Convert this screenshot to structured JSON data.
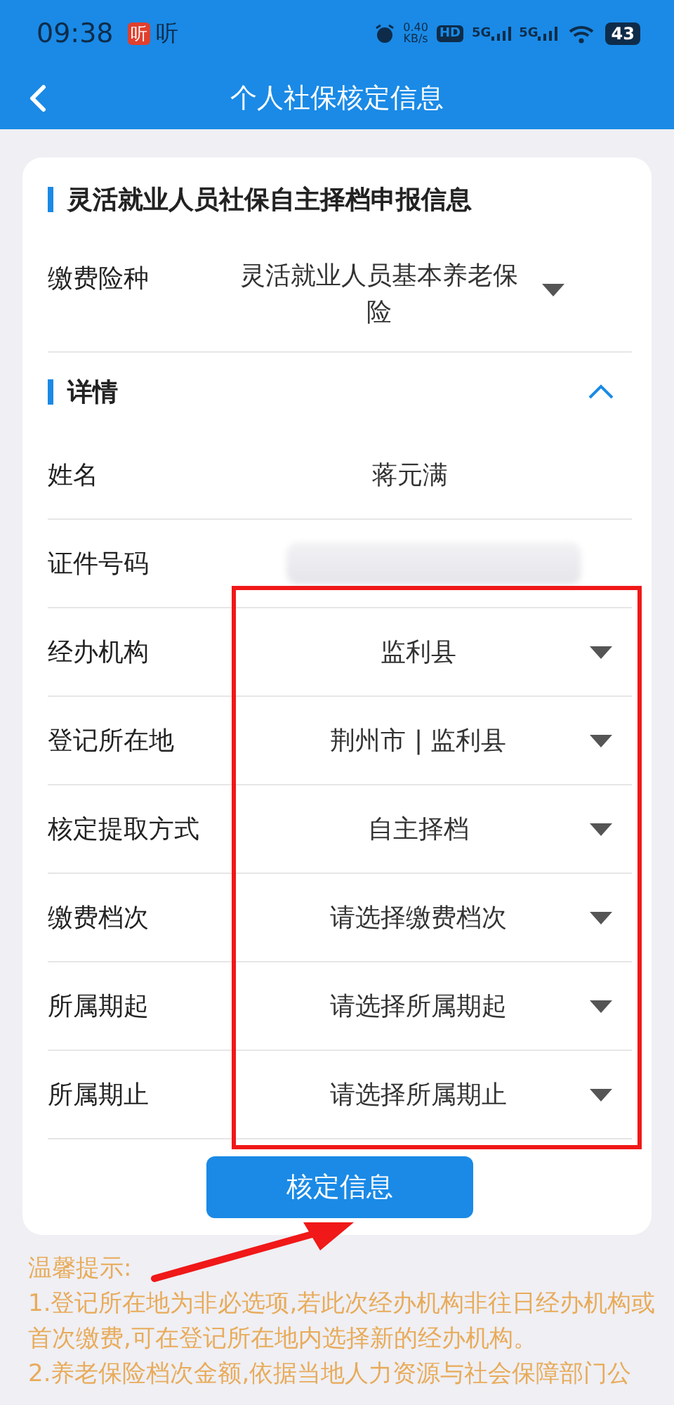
{
  "status_bar": {
    "time": "09:38",
    "app_badge": "听",
    "app_label": "听",
    "speed": "0.40",
    "speed_unit": "KB/s",
    "hd": "HD",
    "sim_1": "5G",
    "sim_2": "5G",
    "battery": "43"
  },
  "header": {
    "title": "个人社保核定信息"
  },
  "section": {
    "title": "灵活就业人员社保自主择档申报信息"
  },
  "insurance": {
    "label": "缴费险种",
    "value": "灵活就业人员基本养老保险"
  },
  "details": {
    "title": "详情",
    "expanded": true,
    "rows": [
      {
        "kind": "text",
        "label": "姓名",
        "value": "蒋元满"
      },
      {
        "kind": "redacted",
        "label": "证件号码"
      },
      {
        "kind": "select",
        "label": "经办机构",
        "value": "监利县"
      },
      {
        "kind": "select",
        "label": "登记所在地",
        "value": "荆州市 | 监利县"
      },
      {
        "kind": "select",
        "label": "核定提取方式",
        "value": "自主择档"
      },
      {
        "kind": "select",
        "label": "缴费档次",
        "placeholder": "请选择缴费档次"
      },
      {
        "kind": "select",
        "label": "所属期起",
        "placeholder": "请选择所属期起"
      },
      {
        "kind": "select",
        "label": "所属期止",
        "placeholder": "请选择所属期止"
      }
    ]
  },
  "submit": {
    "label": "核定信息"
  },
  "tips": {
    "title": "温馨提示:",
    "lines": [
      "1.登记所在地为非必选项,若此次经办机构非往日经办机构或首次缴费,可在登记所在地内选择新的经办机构。",
      "2.养老保险档次金额,依据当地人力资源与社会保障部门公"
    ]
  },
  "annotation": {
    "highlight_box": true,
    "arrow": true
  }
}
